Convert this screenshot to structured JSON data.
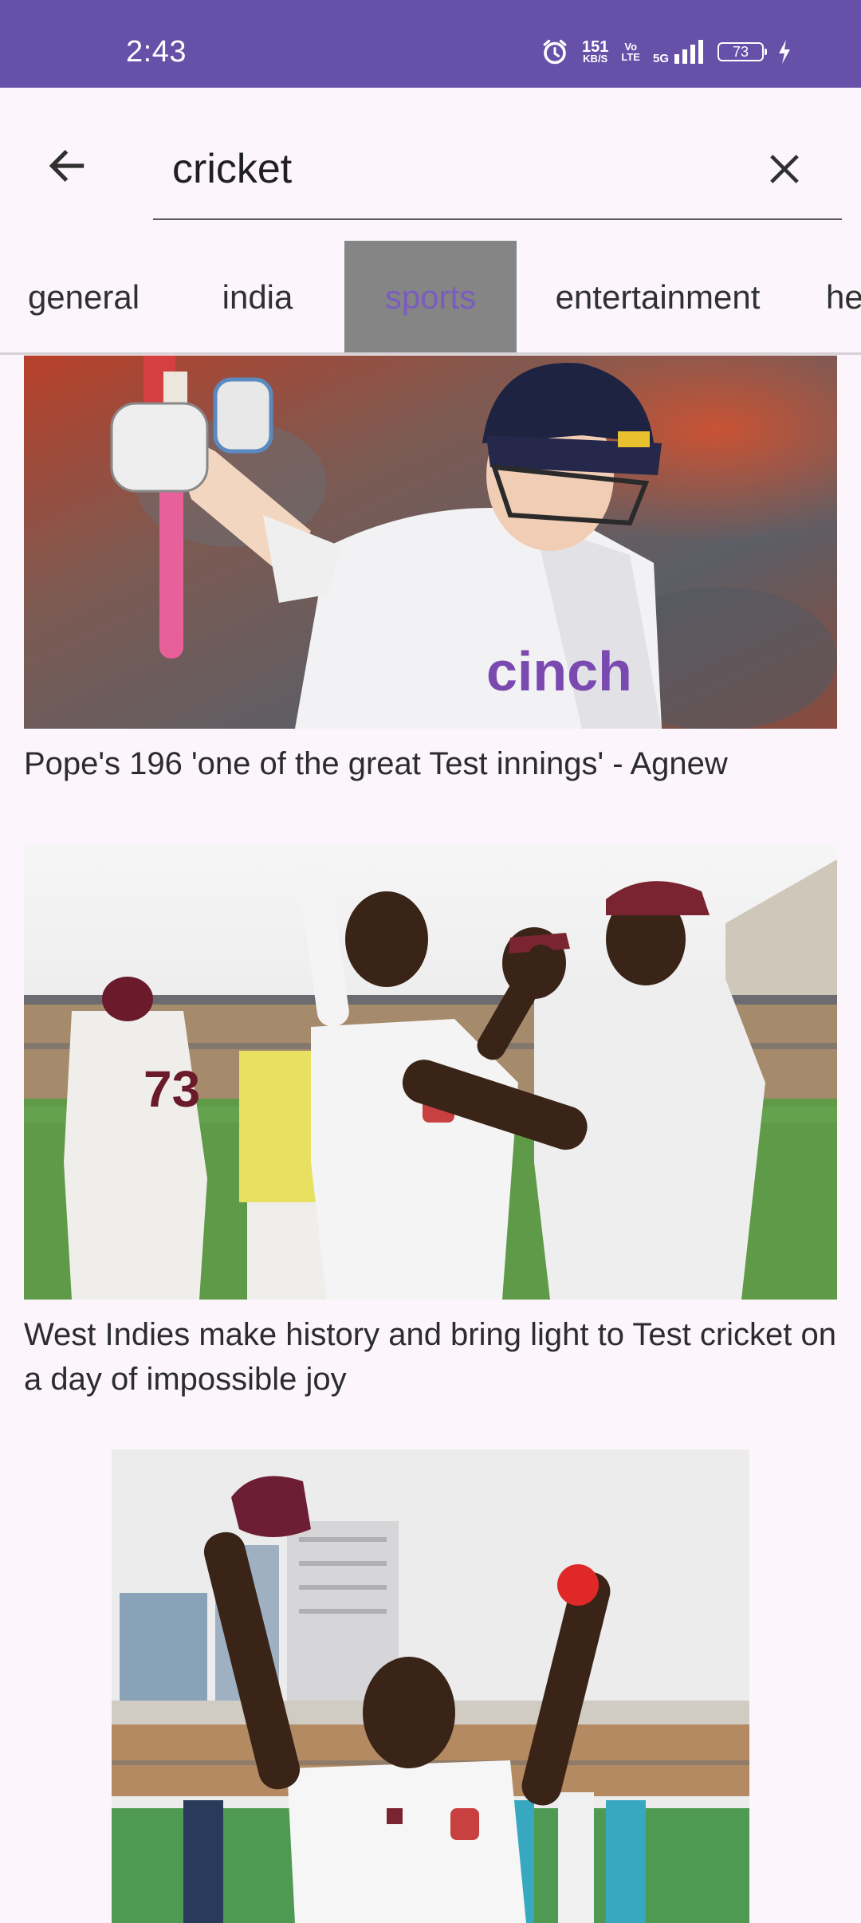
{
  "status_bar": {
    "time": "2:43",
    "network_speed": "151",
    "network_speed_unit": "KB/S",
    "volte_top": "Vo",
    "volte_bottom": "LTE",
    "signal_label": "5G",
    "battery_level": "73",
    "background_color": "#6650a8"
  },
  "search": {
    "query": "cricket",
    "back_icon": "arrow-left-icon",
    "clear_icon": "close-icon"
  },
  "tabs": [
    {
      "label": "general",
      "active": false
    },
    {
      "label": "india",
      "active": false
    },
    {
      "label": "sports",
      "active": true
    },
    {
      "label": "entertainment",
      "active": false
    },
    {
      "label": "he",
      "active": false
    }
  ],
  "articles": [
    {
      "title": "Pope's 196 'one of the great Test innings' - Agnew"
    },
    {
      "title": "West Indies make history and bring light to Test cricket on a day of impossible joy"
    }
  ]
}
